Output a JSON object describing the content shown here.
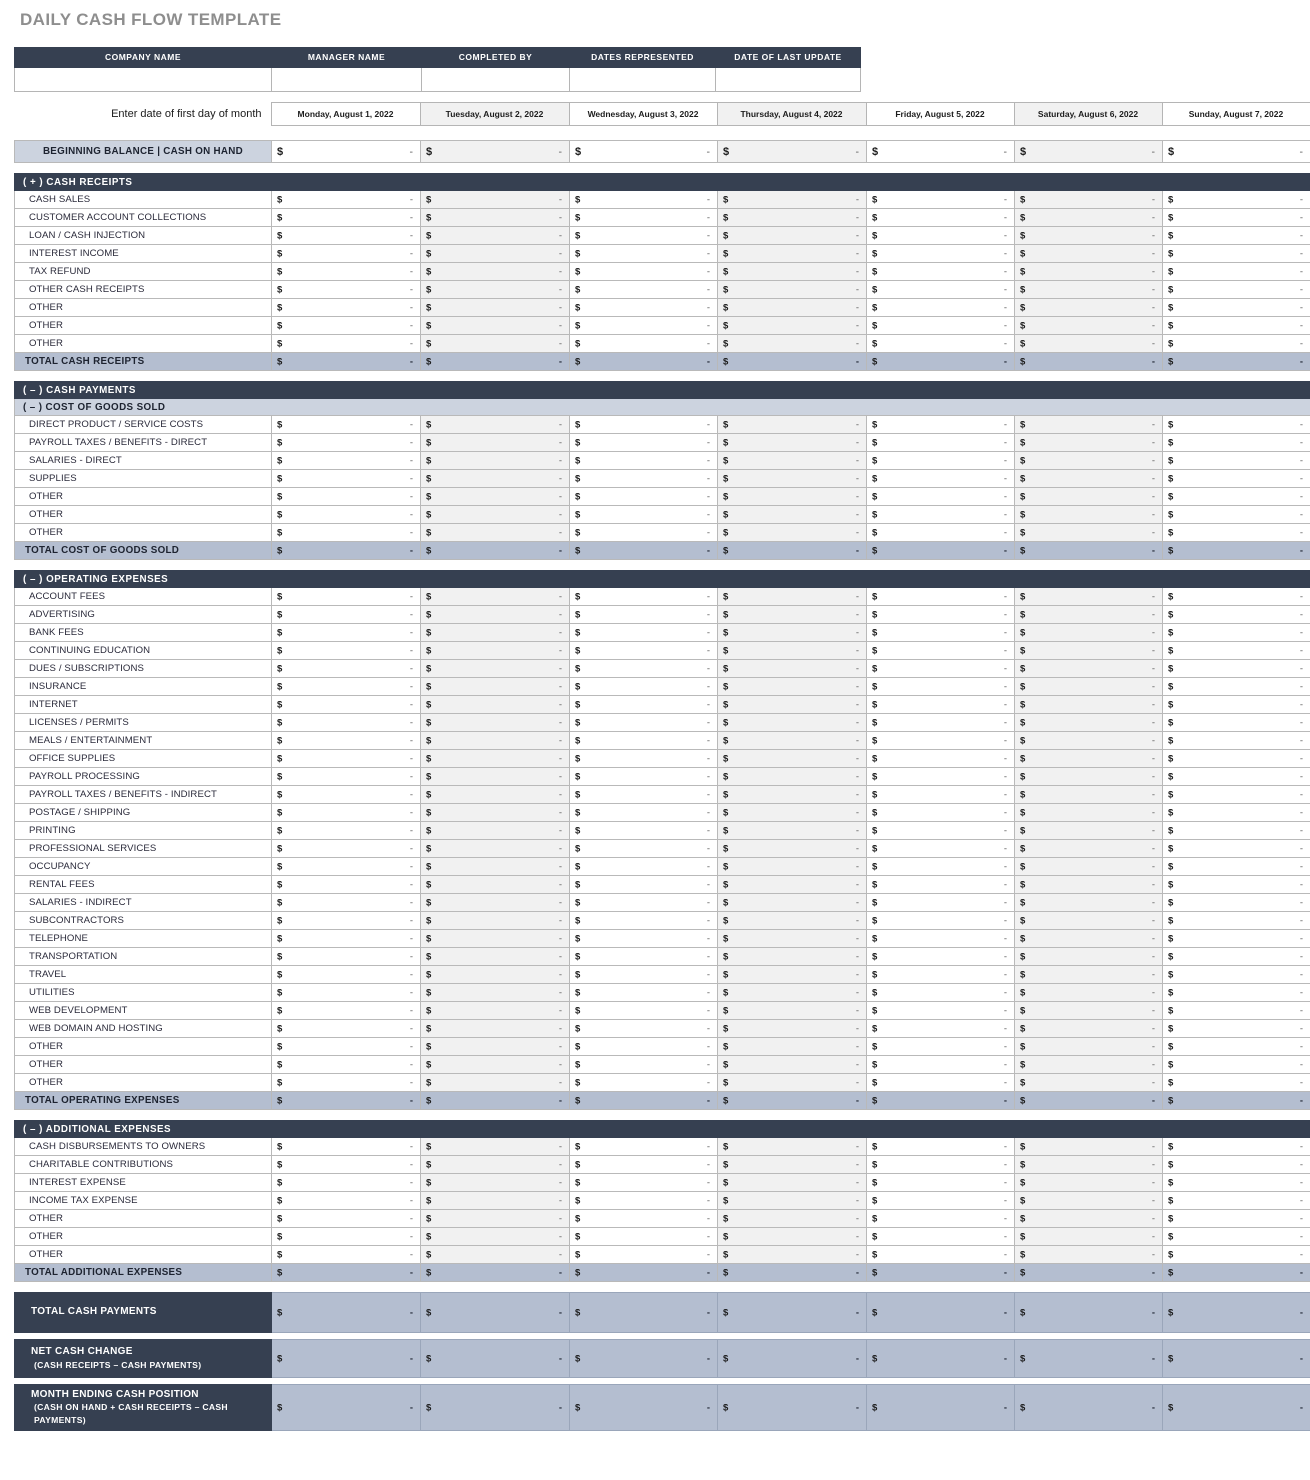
{
  "title": "DAILY CASH FLOW TEMPLATE",
  "info_header": {
    "columns": [
      "COMPANY NAME",
      "MANAGER NAME",
      "COMPLETED BY",
      "DATES REPRESENTED",
      "DATE OF LAST UPDATE"
    ],
    "values": [
      "",
      "",
      "",
      "",
      ""
    ]
  },
  "date_row": {
    "label": "Enter date of first day of month",
    "dates": [
      "Monday, August 1, 2022",
      "Tuesday, August 2, 2022",
      "Wednesday, August 3, 2022",
      "Thursday, August 4, 2022",
      "Friday, August 5, 2022",
      "Saturday, August 6, 2022",
      "Sunday, August 7, 2022"
    ]
  },
  "currency_symbol": "$",
  "empty_value": "-",
  "beginning_balance": {
    "label": "BEGINNING BALANCE  |  CASH ON HAND"
  },
  "sections": [
    {
      "id": "cash-receipts",
      "header": "( + )  CASH RECEIPTS",
      "header_style": "dark",
      "rows": [
        "CASH SALES",
        "CUSTOMER ACCOUNT COLLECTIONS",
        "LOAN / CASH INJECTION",
        "INTEREST INCOME",
        "TAX REFUND",
        "OTHER CASH RECEIPTS",
        "OTHER",
        "OTHER",
        "OTHER"
      ],
      "total": "TOTAL CASH RECEIPTS"
    },
    {
      "id": "cost-of-goods-sold",
      "header": "( – )  CASH PAYMENTS",
      "header_style": "dark",
      "subheader": "( – )  COST OF GOODS SOLD",
      "rows": [
        "DIRECT PRODUCT / SERVICE COSTS",
        "PAYROLL TAXES / BENEFITS - DIRECT",
        "SALARIES - DIRECT",
        "SUPPLIES",
        "OTHER",
        "OTHER",
        "OTHER"
      ],
      "total": "TOTAL COST OF GOODS SOLD"
    },
    {
      "id": "operating-expenses",
      "header": "( – )  OPERATING EXPENSES",
      "header_style": "dark",
      "rows": [
        "ACCOUNT FEES",
        "ADVERTISING",
        "BANK FEES",
        "CONTINUING EDUCATION",
        "DUES / SUBSCRIPTIONS",
        "INSURANCE",
        "INTERNET",
        "LICENSES / PERMITS",
        "MEALS / ENTERTAINMENT",
        "OFFICE SUPPLIES",
        "PAYROLL PROCESSING",
        "PAYROLL TAXES / BENEFITS - INDIRECT",
        "POSTAGE / SHIPPING",
        "PRINTING",
        "PROFESSIONAL SERVICES",
        "OCCUPANCY",
        "RENTAL FEES",
        "SALARIES - INDIRECT",
        "SUBCONTRACTORS",
        "TELEPHONE",
        "TRANSPORTATION",
        "TRAVEL",
        "UTILITIES",
        "WEB DEVELOPMENT",
        "WEB DOMAIN AND HOSTING",
        "OTHER",
        "OTHER",
        "OTHER"
      ],
      "total": "TOTAL OPERATING EXPENSES"
    },
    {
      "id": "additional-expenses",
      "header": "( – )  ADDITIONAL EXPENSES",
      "header_style": "dark",
      "rows": [
        "CASH DISBURSEMENTS TO OWNERS",
        "CHARITABLE CONTRIBUTIONS",
        "INTEREST EXPENSE",
        "INCOME TAX EXPENSE",
        "OTHER",
        "OTHER",
        "OTHER"
      ],
      "total": "TOTAL ADDITIONAL EXPENSES"
    }
  ],
  "grand_rows": [
    {
      "id": "total-cash-payments",
      "label": "TOTAL CASH PAYMENTS",
      "sub": ""
    },
    {
      "id": "net-cash-change",
      "label": "NET CASH CHANGE",
      "sub": "(CASH RECEIPTS – CASH PAYMENTS)"
    },
    {
      "id": "month-ending-cash-position",
      "label": "MONTH ENDING CASH POSITION",
      "sub": "(CASH ON HAND + CASH RECEIPTS – CASH PAYMENTS)"
    }
  ],
  "colors": {
    "header_dark": "#364051",
    "subheader_light": "#ccd3df",
    "total_band": "#b4bed0",
    "alt_cell": "#f1f1f1",
    "title_grey": "#8e8e8e",
    "grid_line": "#b9b9b9"
  }
}
